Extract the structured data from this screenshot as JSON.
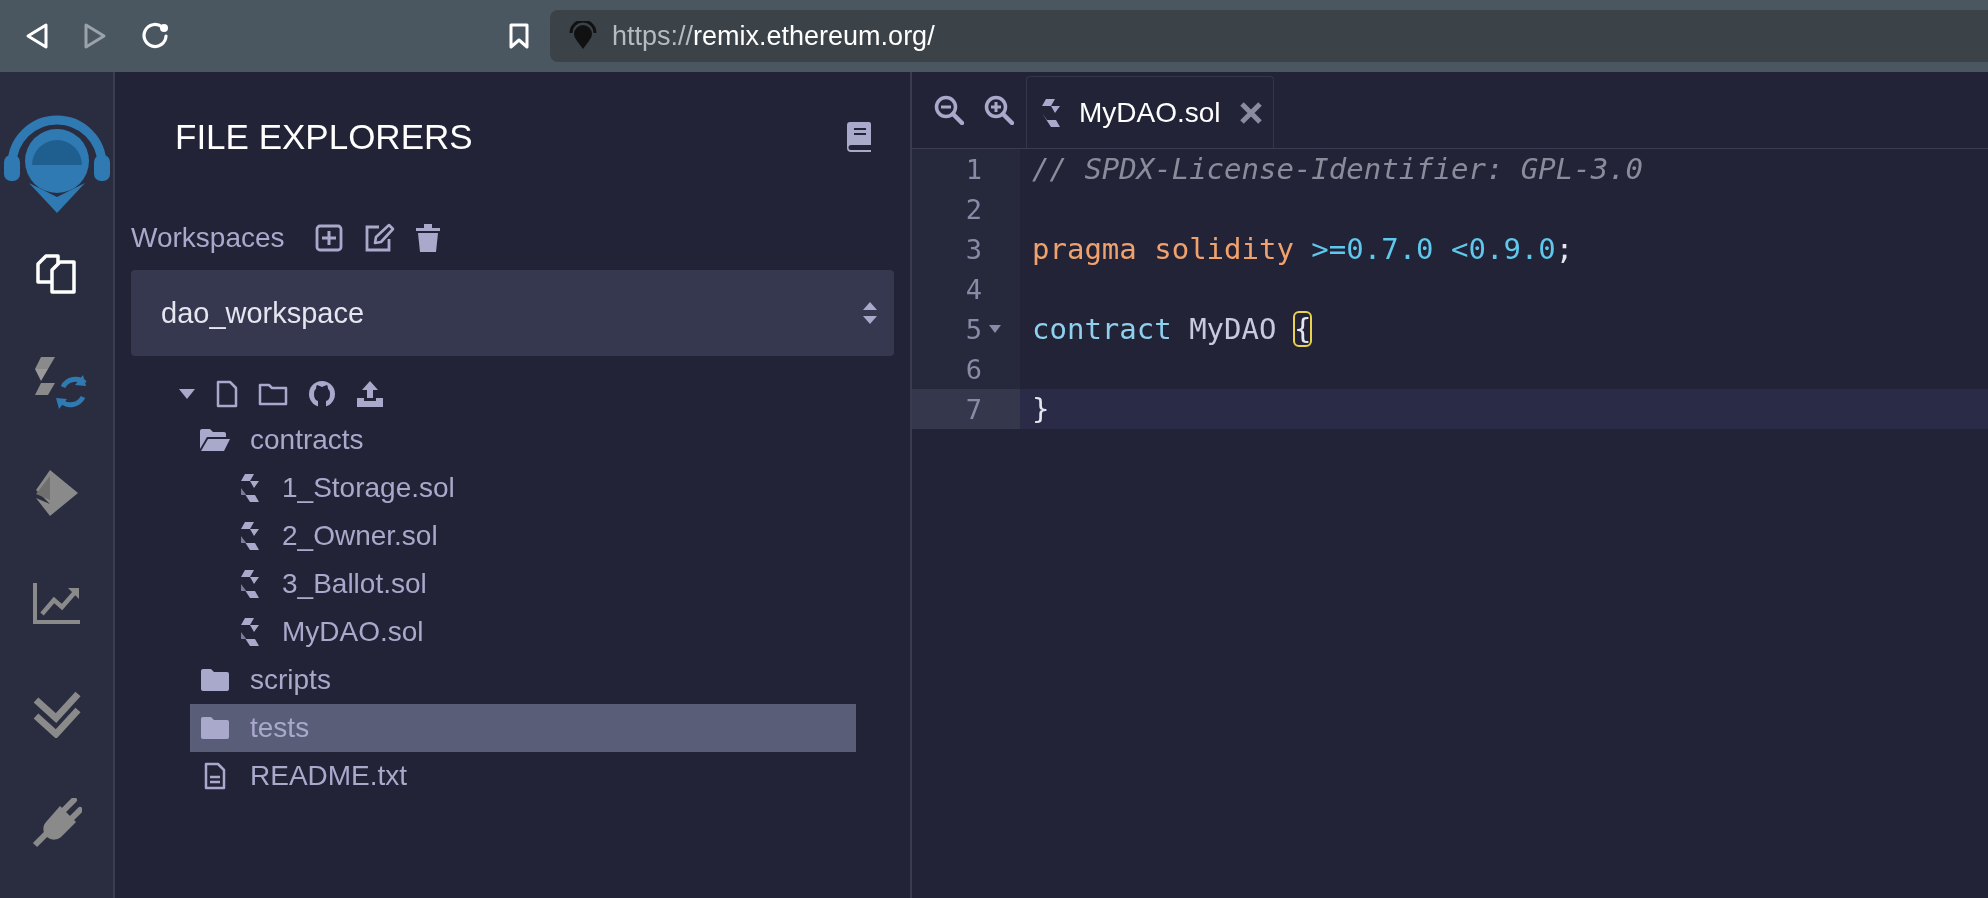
{
  "browser": {
    "url_scheme": "https://",
    "url_rest": "remix.ethereum.org/"
  },
  "icon_panel": [
    {
      "kind": "logo"
    },
    {
      "kind": "files",
      "selected": true
    },
    {
      "kind": "compiler",
      "selected": false
    },
    {
      "kind": "deploy",
      "selected": false
    },
    {
      "kind": "analysis",
      "selected": false
    },
    {
      "kind": "tests",
      "selected": false
    },
    {
      "kind": "plugins",
      "selected": false
    }
  ],
  "side_panel": {
    "title": "FILE EXPLORERS",
    "workspaces_label": "Workspaces",
    "workspace": "dao_workspace",
    "tree": [
      {
        "label": "contracts",
        "kind": "folder",
        "expanded": true,
        "selected": false,
        "children": [
          {
            "label": "1_Storage.sol",
            "kind": "sol",
            "selected": false
          },
          {
            "label": "2_Owner.sol",
            "kind": "sol",
            "selected": false
          },
          {
            "label": "3_Ballot.sol",
            "kind": "sol",
            "selected": false
          },
          {
            "label": "MyDAO.sol",
            "kind": "sol",
            "selected": false
          }
        ]
      },
      {
        "label": "scripts",
        "kind": "folder",
        "expanded": false,
        "selected": false
      },
      {
        "label": "tests",
        "kind": "folder",
        "expanded": false,
        "selected": true
      },
      {
        "label": "README.txt",
        "kind": "file",
        "selected": false
      }
    ]
  },
  "editor": {
    "tabs": [
      {
        "label": "MyDAO.sol",
        "selected": true
      }
    ],
    "lines": [
      {
        "number": "1",
        "active": false,
        "fold": false,
        "tokens": [
          {
            "text": "// SPDX-License-Identifier: GPL-3.0",
            "kind": "comment"
          }
        ]
      },
      {
        "number": "2",
        "active": false,
        "fold": false
      },
      {
        "number": "3",
        "active": false,
        "fold": false,
        "tokens": [
          {
            "text": "pragma solidity ",
            "kind": "keyword"
          },
          {
            "text": ">=0.7.0 <0.9.0",
            "kind": "number"
          },
          {
            "text": ";",
            "kind": "plain"
          }
        ]
      },
      {
        "number": "4",
        "active": false,
        "fold": false
      },
      {
        "number": "5",
        "active": false,
        "fold": true,
        "tokens": [
          {
            "text": "contract",
            "kind": "type"
          },
          {
            "text": " MyDAO ",
            "kind": "name"
          },
          {
            "text": "{",
            "kind": "match"
          }
        ]
      },
      {
        "number": "6",
        "active": false,
        "fold": false
      },
      {
        "number": "7",
        "active": true,
        "fold": false,
        "tokens": [
          {
            "text": "}",
            "kind": "plain"
          }
        ]
      }
    ]
  }
}
